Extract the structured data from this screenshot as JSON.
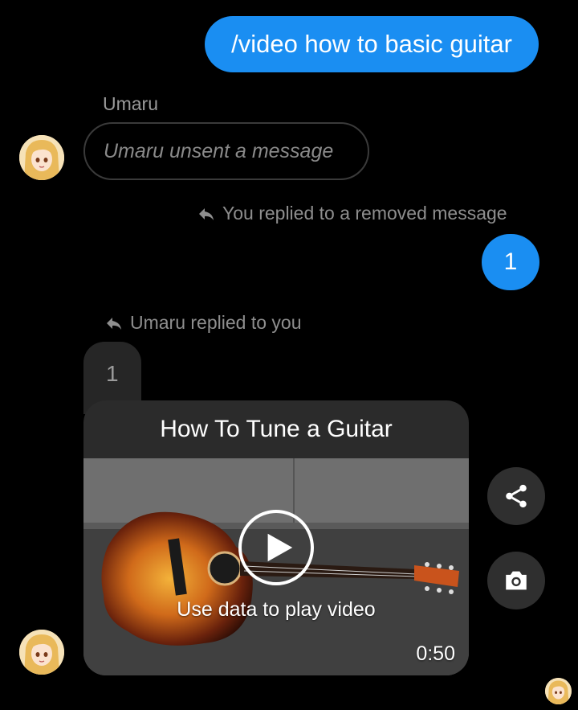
{
  "messages": {
    "outgoing_1": "/video how to basic guitar",
    "sender_name": "Umaru",
    "unsent": "Umaru unsent a message",
    "reply_note_1": "You replied to a removed message",
    "outgoing_2": "1",
    "reply_note_2": "Umaru replied to you",
    "quoted_text": "1"
  },
  "video_card": {
    "title": "How To Tune a Guitar",
    "play_message": "Use data to play video",
    "duration": "0:50"
  },
  "icons": {
    "share": "share-icon",
    "camera": "camera-icon",
    "reply": "reply-arrow-icon",
    "play": "play-icon"
  },
  "colors": {
    "outgoing_bubble": "#1a8ef2",
    "background": "#000000",
    "card": "#2b2b2b"
  }
}
